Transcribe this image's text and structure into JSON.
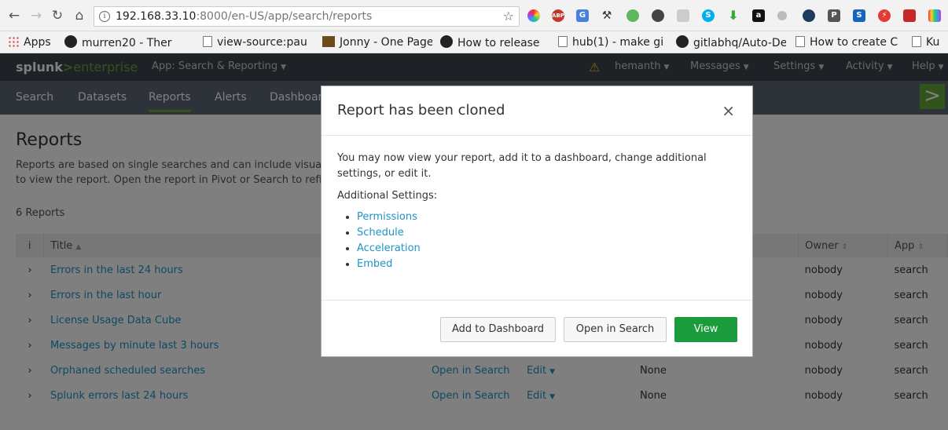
{
  "browser": {
    "url_host": "192.168.33.10",
    "url_rest": ":8000/en-US/app/search/reports",
    "bookmarks": [
      {
        "label": "Apps",
        "icon": "apps-grid-icon"
      },
      {
        "label": "murren20 - Ther",
        "icon": "github-icon"
      },
      {
        "label": "view-source:pau",
        "icon": "page-icon"
      },
      {
        "label": "Jonny - One Page",
        "icon": "bookmark-image-icon"
      },
      {
        "label": "How to release",
        "icon": "github-icon"
      },
      {
        "label": "hub(1) - make gi",
        "icon": "page-icon"
      },
      {
        "label": "gitlabhq/Auto-De",
        "icon": "github-icon"
      },
      {
        "label": "How to create C",
        "icon": "page-icon"
      },
      {
        "label": "Ku",
        "icon": "page-icon"
      }
    ]
  },
  "splunkbar": {
    "logo_a": "splunk",
    "logo_gt": ">",
    "logo_b": "enterprise",
    "app_label": "App: Search & Reporting",
    "user": "hemanth",
    "messages": "Messages",
    "settings": "Settings",
    "activity": "Activity",
    "help": "Help"
  },
  "appbar": {
    "tabs": [
      "Search",
      "Datasets",
      "Reports",
      "Alerts",
      "Dashboards"
    ]
  },
  "page": {
    "title": "Reports",
    "description": "Reports are based on single searches and can include visual ... to view the report. Open the report in Pivot or Search to refi...",
    "desc_line1": "Reports are based on single searches and can include visua",
    "desc_line2": "to view the report. Open the report in Pivot or Search to refi",
    "count": "6 Reports"
  },
  "table": {
    "headers": {
      "info": "i",
      "title": "Title",
      "owner": "Owner",
      "app": "App"
    },
    "rows": [
      {
        "title": "Errors in the last 24 hours",
        "actions": "",
        "edit": "",
        "schedule": "",
        "owner": "nobody",
        "app": "search"
      },
      {
        "title": "Errors in the last hour",
        "actions": "",
        "edit": "",
        "schedule": "",
        "owner": "nobody",
        "app": "search"
      },
      {
        "title": "License Usage Data Cube",
        "actions": "",
        "edit": "",
        "schedule": "",
        "owner": "nobody",
        "app": "search"
      },
      {
        "title": "Messages by minute last 3 hours",
        "actions": "",
        "edit": "",
        "schedule": "",
        "owner": "nobody",
        "app": "search"
      },
      {
        "title": "Orphaned scheduled searches",
        "actions": "Open in Search",
        "edit": "Edit",
        "schedule": "None",
        "owner": "nobody",
        "app": "search"
      },
      {
        "title": "Splunk errors last 24 hours",
        "actions": "Open in Search",
        "edit": "Edit",
        "schedule": "None",
        "owner": "nobody",
        "app": "search"
      }
    ]
  },
  "modal": {
    "title": "Report has been cloned",
    "close": "×",
    "message": "You may now view your report, add it to a dashboard, change additional settings, or edit it.",
    "additional": "Additional Settings:",
    "links": [
      "Permissions",
      "Schedule",
      "Acceleration",
      "Embed"
    ],
    "buttons": {
      "add": "Add to Dashboard",
      "open": "Open in Search",
      "view": "View"
    }
  },
  "colors": {
    "accent_green": "#1a9c3c",
    "link_blue": "#1e93c6",
    "splunk_bar": "#3c444d",
    "app_bar": "#5c6773"
  }
}
